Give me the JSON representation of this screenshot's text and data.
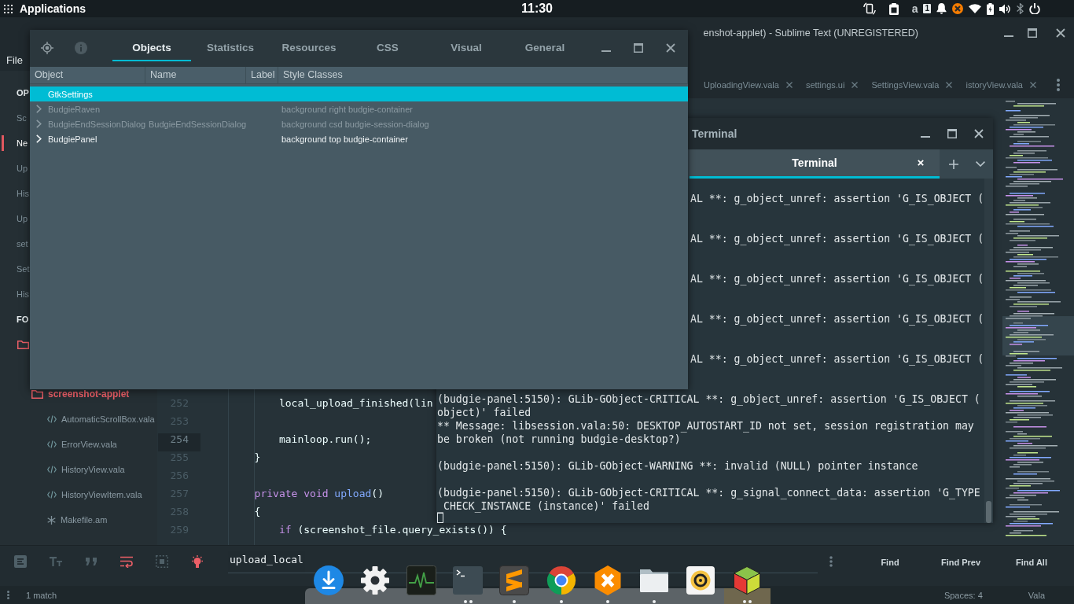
{
  "top_panel": {
    "menu_label": "Applications",
    "clock": "11:30",
    "keyboard_layout": "a",
    "badge": "1"
  },
  "sublime": {
    "title": "enshot-applet) - Sublime Text (UNREGISTERED)",
    "menu": [
      "File"
    ],
    "sidebar": {
      "open_files_header": "OP",
      "open_files": [
        {
          "label": "Sc",
          "selected": false
        },
        {
          "label": "Ne",
          "selected": true
        },
        {
          "label": "Up",
          "selected": false
        },
        {
          "label": "His",
          "selected": false
        },
        {
          "label": "Up",
          "selected": false
        },
        {
          "label": "set",
          "selected": false
        },
        {
          "label": "Set",
          "selected": false
        },
        {
          "label": "His",
          "selected": false
        }
      ],
      "folders_header": "FO",
      "folders": [
        {
          "kind": "folder",
          "children": [
            {
              "kind": "folder",
              "label": "screenshot-applet",
              "children": [
                {
                  "kind": "source",
                  "label": "AutomaticScrollBox.vala"
                },
                {
                  "kind": "source",
                  "label": "ErrorView.vala"
                },
                {
                  "kind": "source",
                  "label": "HistoryView.vala"
                },
                {
                  "kind": "source",
                  "label": "HistoryViewItem.vala"
                },
                {
                  "kind": "build",
                  "label": "Makefile.am"
                }
              ]
            }
          ]
        }
      ]
    },
    "tabs": [
      {
        "label": "UploadingView.vala",
        "selected": false
      },
      {
        "label": "settings.ui",
        "selected": false
      },
      {
        "label": "SettingsView.vala",
        "selected": false
      },
      {
        "label": "istoryView.vala",
        "selected": false
      }
    ],
    "lines": [
      {
        "number": "252",
        "current": false,
        "tokens": [
          {
            "kind": "plain",
            "text": "            local_upload_finished(lin"
          }
        ]
      },
      {
        "number": "253",
        "current": false
      },
      {
        "number": "254",
        "current": true,
        "tokens": [
          {
            "kind": "plain",
            "text": "            mainloop.run();"
          }
        ]
      },
      {
        "number": "255",
        "current": false,
        "tokens": [
          {
            "kind": "plain",
            "text": "        }"
          }
        ]
      },
      {
        "number": "256",
        "current": false
      },
      {
        "number": "257",
        "current": false,
        "tokens": [
          {
            "kind": "keyword",
            "text": "        private void"
          },
          {
            "kind": "function",
            "text": " upload"
          },
          {
            "kind": "plain",
            "text": "()"
          }
        ]
      },
      {
        "number": "258",
        "current": false,
        "tokens": [
          {
            "kind": "plain",
            "text": "        {"
          }
        ]
      },
      {
        "number": "259",
        "current": false,
        "tokens": [
          {
            "kind": "keyword",
            "text": "            if"
          },
          {
            "kind": "plain",
            "text": " (screenshot_file.query_exists()) {"
          }
        ]
      }
    ],
    "find": {
      "options": [
        {
          "kind": "regex",
          "on": false
        },
        {
          "kind": "case",
          "on": false
        },
        {
          "kind": "word",
          "on": false
        },
        {
          "kind": "wrap",
          "on": true
        },
        {
          "kind": "selection",
          "on": false
        },
        {
          "kind": "highlight",
          "on": true
        }
      ],
      "query": "upload_local",
      "buttons": [
        "Find",
        "Find Prev",
        "Find All"
      ]
    },
    "status_bar": {
      "matches": "1 match",
      "indentation": "Spaces: 4",
      "syntax": "Vala"
    }
  },
  "terminal": {
    "title": "Terminal",
    "tabs": [
      {
        "label": "Terminal",
        "selected": true
      }
    ],
    "blocks": [
      {
        "kind": "cut",
        "lines": [
          "AL **: g_object_unref: assertion 'G_IS_OBJECT ("
        ]
      },
      {
        "kind": "cut",
        "lines": [
          "AL **: g_object_unref: assertion 'G_IS_OBJECT ("
        ]
      },
      {
        "kind": "cut",
        "lines": [
          "AL **: g_object_unref: assertion 'G_IS_OBJECT ("
        ]
      },
      {
        "kind": "cut",
        "lines": [
          "AL **: g_object_unref: assertion 'G_IS_OBJECT ("
        ]
      },
      {
        "kind": "cut",
        "lines": [
          "AL **: g_object_unref: assertion 'G_IS_OBJECT ("
        ]
      },
      {
        "kind": "full",
        "lines": [
          "(budgie-panel:5150): GLib-GObject-CRITICAL **: g_object_unref: assertion 'G_IS_OBJECT (",
          "object)' failed",
          "** Message: libsession.vala:50: DESKTOP_AUTOSTART_ID not set, session registration may",
          "be broken (not running budgie-desktop?)"
        ]
      },
      {
        "kind": "full",
        "lines": [
          "(budgie-panel:5150): GLib-GObject-WARNING **: invalid (NULL) pointer instance"
        ]
      },
      {
        "kind": "full",
        "lines": [
          "(budgie-panel:5150): GLib-GObject-CRITICAL **: g_signal_connect_data: assertion 'G_TYPE",
          "_CHECK_INSTANCE (instance)' failed"
        ]
      }
    ]
  },
  "inspector": {
    "tools": [
      {
        "kind": "picker",
        "disabled": false
      },
      {
        "kind": "details",
        "disabled": true
      }
    ],
    "tabs": [
      {
        "label": "Objects",
        "selected": true
      },
      {
        "label": "Statistics",
        "selected": false
      },
      {
        "label": "Resources",
        "selected": false
      },
      {
        "label": "CSS",
        "selected": false
      },
      {
        "label": "Visual",
        "selected": false
      },
      {
        "label": "General",
        "selected": false
      }
    ],
    "columns": [
      "Object",
      "Name",
      "Label",
      "Style Classes"
    ],
    "rows": [
      {
        "object": "GtkSettings",
        "selected": true,
        "expandable": false,
        "dimmed": false
      },
      {
        "object": "BudgieRaven",
        "style_classes": "background right budgie-container",
        "selected": false,
        "expandable": true,
        "dimmed": true
      },
      {
        "object": "BudgieEndSessionDialog",
        "name": "BudgieEndSessionDialog",
        "style_classes": "background csd budgie-session-dialog",
        "selected": false,
        "expandable": true,
        "dimmed": true
      },
      {
        "object": "BudgiePanel",
        "style_classes": "background top budgie-container",
        "selected": false,
        "expandable": true,
        "dimmed": false
      }
    ]
  },
  "dock": {
    "apps": [
      {
        "kind": "download",
        "running": false,
        "active": false
      },
      {
        "kind": "settings",
        "running": false,
        "active": false
      },
      {
        "kind": "monitor",
        "running": false,
        "active": false
      },
      {
        "kind": "terminal",
        "running": true,
        "multiple": true,
        "active": false
      },
      {
        "kind": "editor",
        "running": true,
        "multiple": false,
        "active": false
      },
      {
        "kind": "browser",
        "running": true,
        "multiple": false,
        "active": false
      },
      {
        "kind": "hexagon",
        "running": true,
        "multiple": false,
        "active": false
      },
      {
        "kind": "files",
        "running": true,
        "multiple": false,
        "active": false
      },
      {
        "kind": "music",
        "running": false,
        "active": false
      },
      {
        "kind": "cube",
        "running": true,
        "multiple": true,
        "active": true
      }
    ]
  }
}
